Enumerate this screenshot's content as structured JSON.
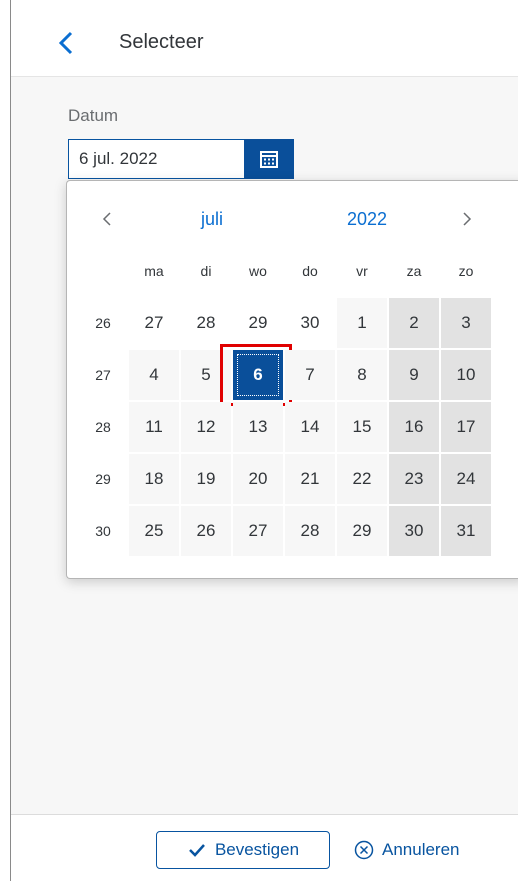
{
  "header": {
    "title": "Selecteer"
  },
  "form": {
    "date_label": "Datum",
    "date_value": "6 jul. 2022"
  },
  "calendar": {
    "month_label": "juli",
    "year_label": "2022",
    "day_names": [
      "ma",
      "di",
      "wo",
      "do",
      "vr",
      "za",
      "zo"
    ],
    "weeks": [
      {
        "week": "26",
        "days": [
          "27",
          "28",
          "29",
          "30",
          "1",
          "2",
          "3"
        ]
      },
      {
        "week": "27",
        "days": [
          "4",
          "5",
          "6",
          "7",
          "8",
          "9",
          "10"
        ]
      },
      {
        "week": "28",
        "days": [
          "11",
          "12",
          "13",
          "14",
          "15",
          "16",
          "17"
        ]
      },
      {
        "week": "29",
        "days": [
          "18",
          "19",
          "20",
          "21",
          "22",
          "23",
          "24"
        ]
      },
      {
        "week": "30",
        "days": [
          "25",
          "26",
          "27",
          "28",
          "29",
          "30",
          "31"
        ]
      }
    ],
    "selected_day": "6"
  },
  "footer": {
    "confirm_label": "Bevestigen",
    "cancel_label": "Annuleren"
  },
  "colors": {
    "accent": "#0a4f9a",
    "link": "#0a6ed1",
    "highlight": "#e00000"
  },
  "icons": {
    "back": "chevron-left-icon",
    "calendar": "calendar-icon",
    "prev": "chevron-left-icon",
    "next": "chevron-right-icon",
    "confirm": "checkmark-icon",
    "cancel": "cancel-circle-icon"
  }
}
